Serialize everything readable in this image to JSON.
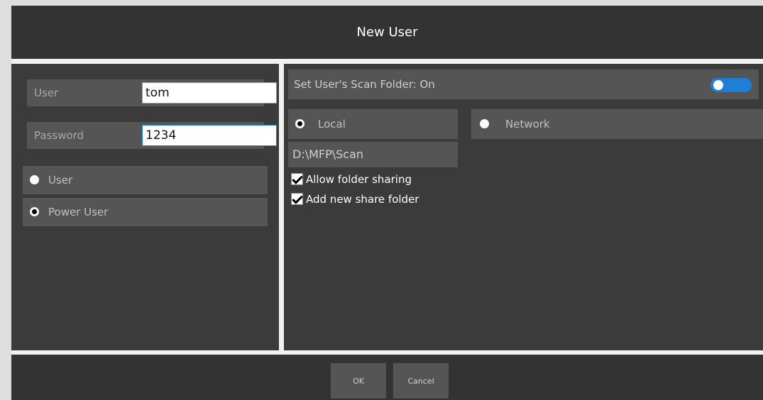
{
  "dialog": {
    "title": "New User"
  },
  "left": {
    "user_label": "User",
    "user_value": "tom",
    "password_label": "Password",
    "password_value": "1234",
    "roles": [
      {
        "label": "User",
        "selected": false
      },
      {
        "label": "Power User",
        "selected": true
      }
    ]
  },
  "right": {
    "scan_folder_label": "Set User's Scan Folder: On",
    "scan_folder_toggle": "on",
    "location_options": [
      {
        "label": "Local",
        "selected": true
      },
      {
        "label": "Network",
        "selected": false
      }
    ],
    "path": "D:\\MFP\\Scan",
    "checks": [
      {
        "label": "Allow folder sharing",
        "checked": true
      },
      {
        "label": "Add new share folder",
        "checked": true
      }
    ]
  },
  "footer": {
    "ok_label": "OK",
    "cancel_label": "Cancel"
  },
  "colors": {
    "toggle_on": "#1e7fd8",
    "panel": "#3b3b3b",
    "row": "#555555"
  }
}
